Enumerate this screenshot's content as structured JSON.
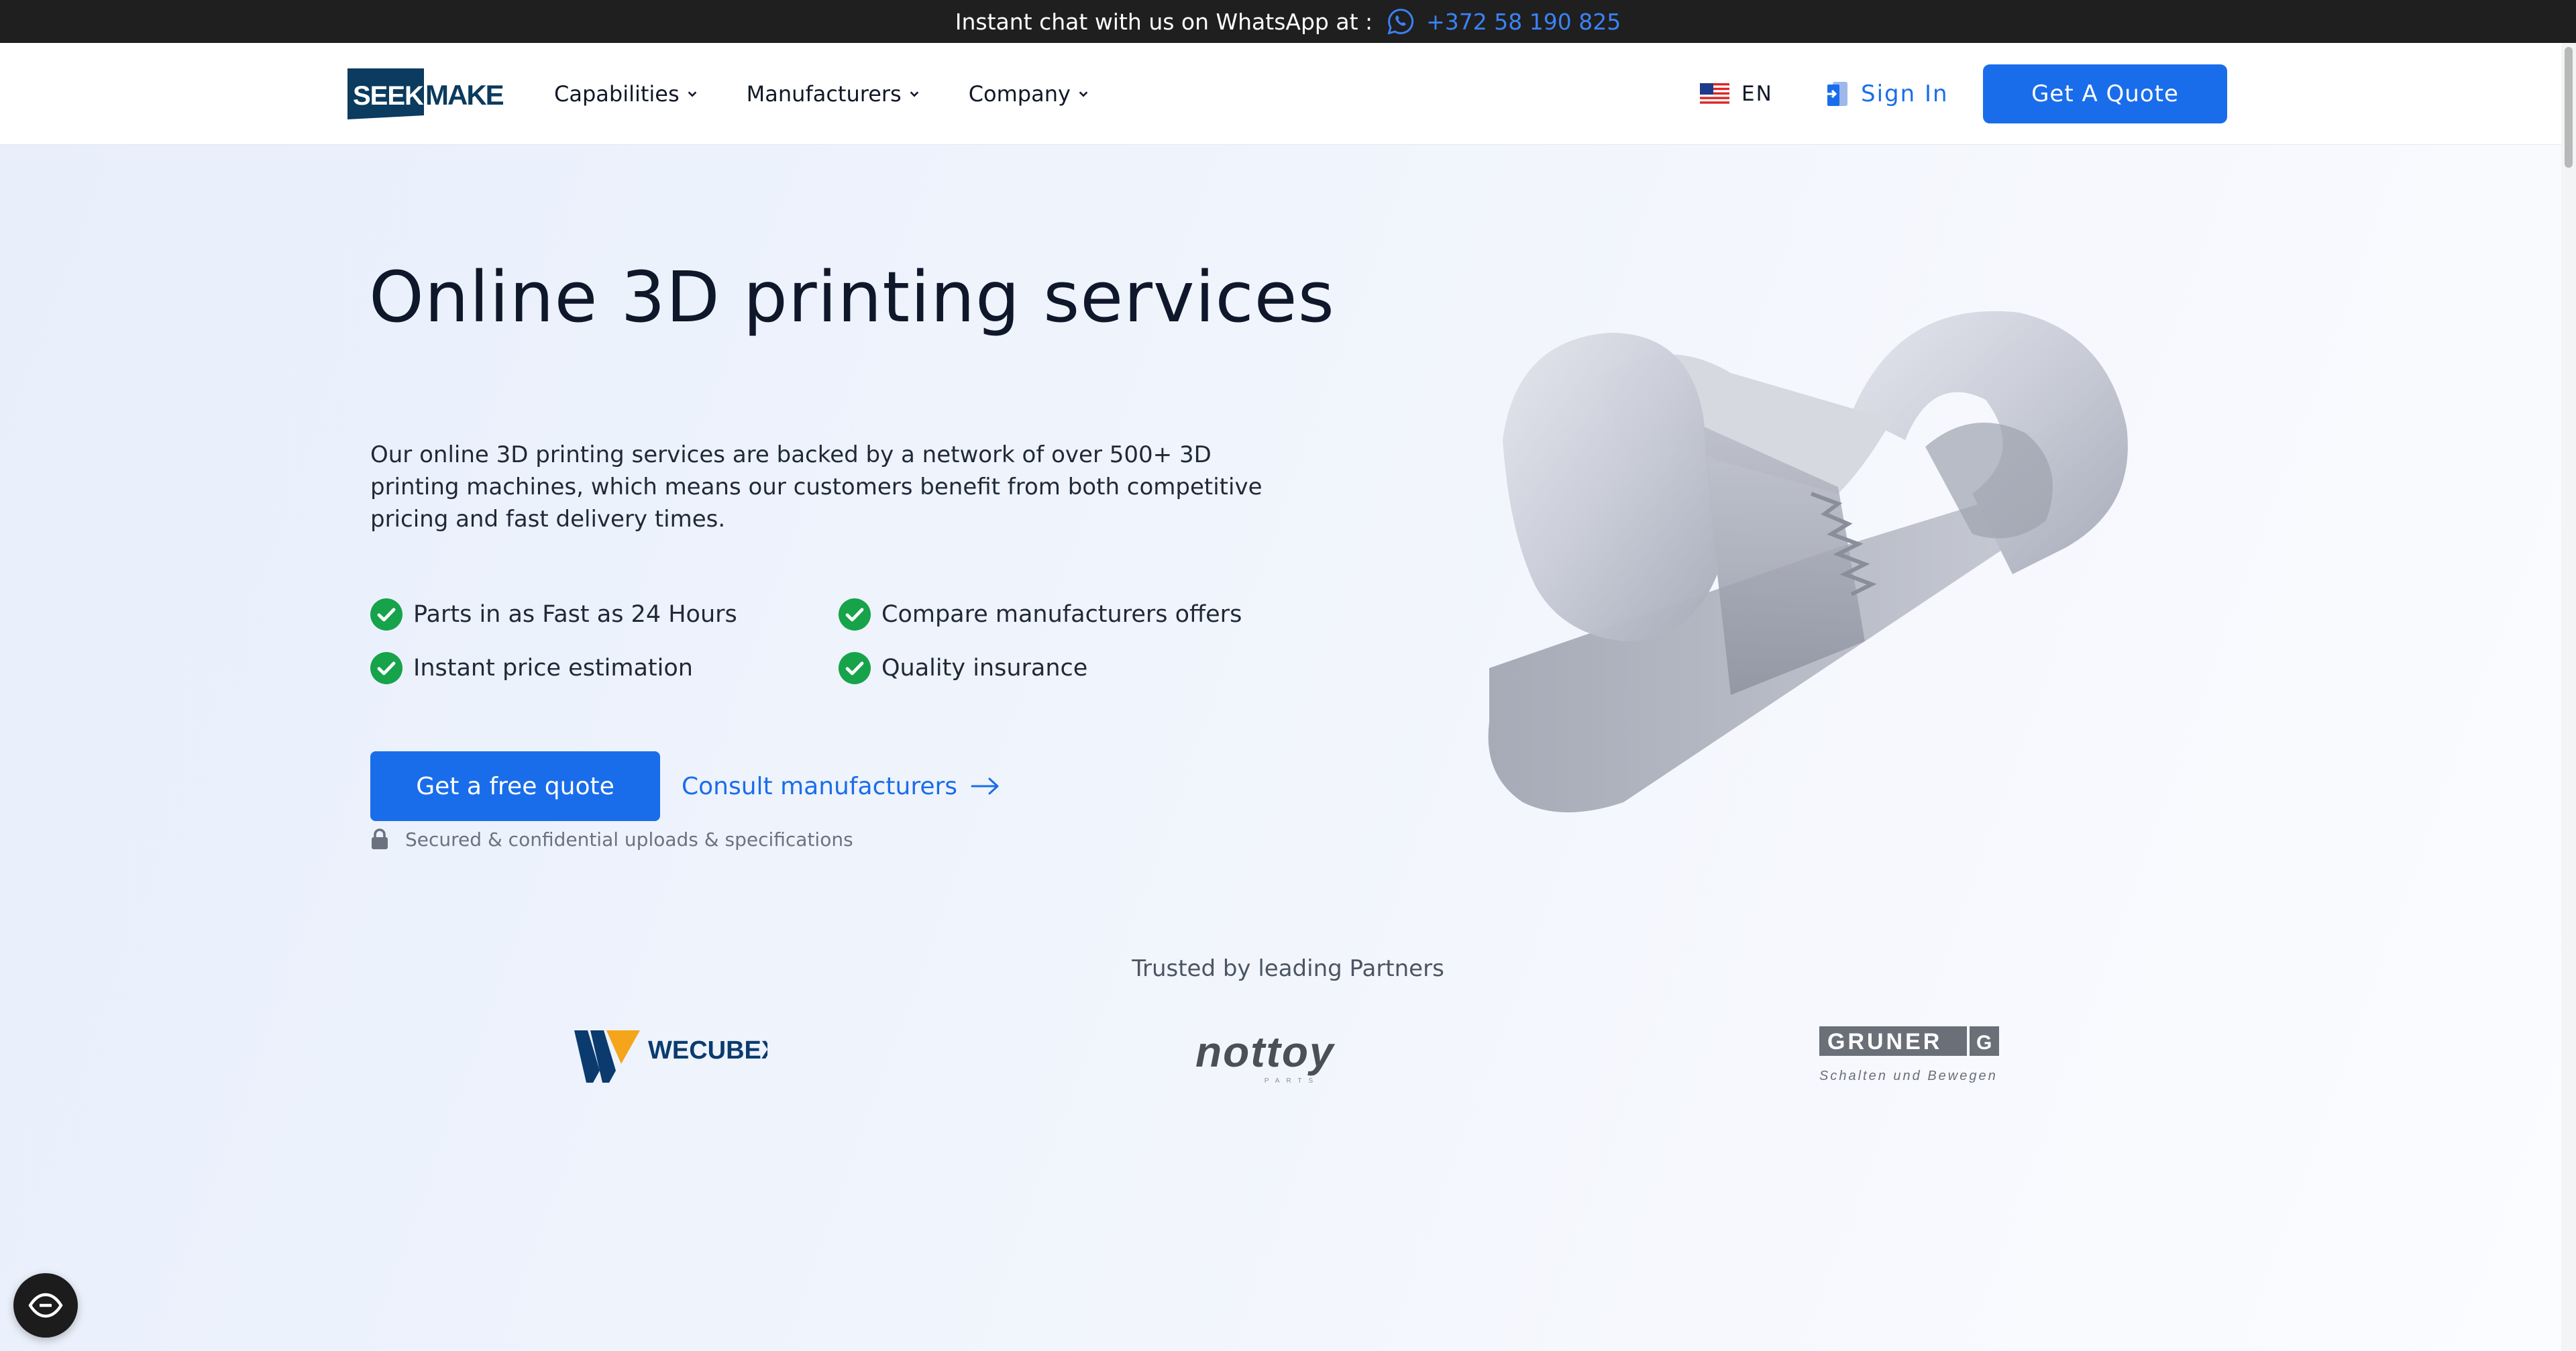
{
  "topbar": {
    "text": "Instant chat with us on WhatsApp at :",
    "phone": "+372 58 190 825",
    "icon": "whatsapp-icon"
  },
  "header": {
    "logo_text": "SEEKMAKE",
    "nav": [
      {
        "label": "Capabilities",
        "icon": "chevron-down-icon"
      },
      {
        "label": "Manufacturers",
        "icon": "chevron-down-icon"
      },
      {
        "label": "Company",
        "icon": "chevron-down-icon"
      }
    ],
    "language": {
      "label": "EN",
      "icon": "us-flag-icon"
    },
    "sign_in": {
      "label": "Sign In",
      "icon": "sign-in-icon"
    },
    "quote_button": "Get A Quote"
  },
  "hero": {
    "title": "Online 3D printing services",
    "description": "Our online 3D printing services are backed by a network of over 500+ 3D printing machines, which means our customers benefit from both competitive pricing and fast delivery times.",
    "features": [
      "Parts in as Fast as 24 Hours",
      "Compare manufacturers offers",
      "Instant price estimation",
      "Quality insurance"
    ],
    "primary_cta": "Get a free quote",
    "secondary_cta": "Consult manufacturers",
    "secure_note": "Secured & confidential uploads & specifications",
    "image": "3d-printed-clip-part"
  },
  "partners": {
    "title": "Trusted by leading Partners",
    "logos": [
      {
        "name": "WECUBEX"
      },
      {
        "name": "nottoy",
        "subtext": "PARTS"
      },
      {
        "name": "GRUNER",
        "subtext": "Schalten und Bewegen"
      }
    ]
  },
  "colors": {
    "accent": "#1a6dea",
    "check": "#16a34a",
    "topbar_bg": "#1f1f1f",
    "heading": "#0f172a",
    "logo_navy": "#0b3b5e"
  },
  "accessibility_button": {
    "icon": "accessibility-eye-icon"
  }
}
